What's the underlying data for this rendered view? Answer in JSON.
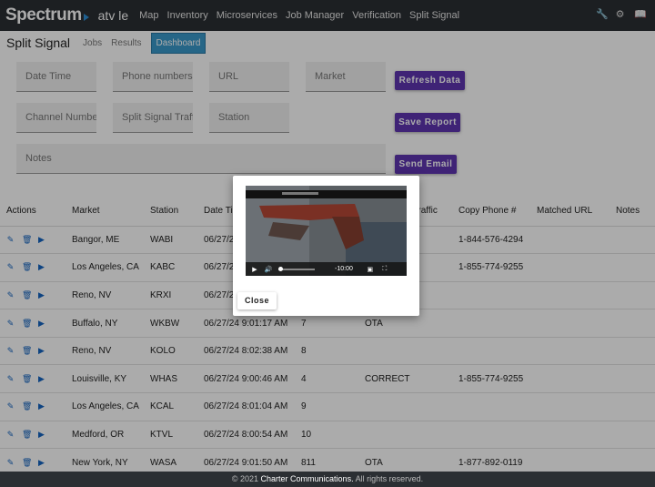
{
  "header": {
    "brand": "Spectrum",
    "app_name": "atv le",
    "nav": [
      "Map",
      "Inventory",
      "Microservices",
      "Job Manager",
      "Verification",
      "Split Signal"
    ],
    "icons": [
      "wrench-icon",
      "gear-icon",
      "book-icon"
    ]
  },
  "subheader": {
    "title": "Split Signal",
    "tabs": [
      {
        "label": "Jobs",
        "active": false
      },
      {
        "label": "Results",
        "active": false
      },
      {
        "label": "Dashboard",
        "active": true
      }
    ]
  },
  "filters": {
    "date_time": "Date Time",
    "phone_numbers": "Phone numbers",
    "url": "URL",
    "market": "Market",
    "channel_number": "Channel Number",
    "split_signal_traffic": "Split Signal Traffic",
    "station": "Station",
    "notes": "Notes"
  },
  "buttons": {
    "refresh": "Refresh Data",
    "save": "Save Report",
    "email": "Send Email"
  },
  "table": {
    "headers": [
      "Actions",
      "Market",
      "Station",
      "Date Time",
      "",
      "Split Signal Traffic",
      "Copy Phone #",
      "Matched URL",
      "Notes"
    ],
    "rows": [
      {
        "market": "Bangor, ME",
        "station": "WABI",
        "datetime": "06/27/24",
        "channel": "",
        "traffic": "",
        "phone": "1-844-576-4294",
        "url": "",
        "notes": ""
      },
      {
        "market": "Los Angeles, CA",
        "station": "KABC",
        "datetime": "06/27/24",
        "channel": "",
        "traffic": "",
        "phone": "1-855-774-9255",
        "url": "",
        "notes": ""
      },
      {
        "market": "Reno, NV",
        "station": "KRXI",
        "datetime": "06/27/24",
        "channel": "",
        "traffic": "",
        "phone": "",
        "url": "",
        "notes": ""
      },
      {
        "market": "Buffalo, NY",
        "station": "WKBW",
        "datetime": "06/27/24 9:01:17 AM",
        "channel": "7",
        "traffic": "OTA",
        "phone": "",
        "url": "",
        "notes": ""
      },
      {
        "market": "Reno, NV",
        "station": "KOLO",
        "datetime": "06/27/24 8:02:38 AM",
        "channel": "8",
        "traffic": "",
        "phone": "",
        "url": "",
        "notes": ""
      },
      {
        "market": "Louisville, KY",
        "station": "WHAS",
        "datetime": "06/27/24 9:00:46 AM",
        "channel": "4",
        "traffic": "CORRECT",
        "phone": "1-855-774-9255",
        "url": "",
        "notes": ""
      },
      {
        "market": "Los Angeles, CA",
        "station": "KCAL",
        "datetime": "06/27/24 8:01:04 AM",
        "channel": "9",
        "traffic": "",
        "phone": "",
        "url": "",
        "notes": ""
      },
      {
        "market": "Medford, OR",
        "station": "KTVL",
        "datetime": "06/27/24 8:00:54 AM",
        "channel": "10",
        "traffic": "",
        "phone": "",
        "url": "",
        "notes": ""
      },
      {
        "market": "New York, NY",
        "station": "WASA",
        "datetime": "06/27/24 9:01:50 AM",
        "channel": "811",
        "traffic": "OTA",
        "phone": "1-877-892-0119",
        "url": "",
        "notes": ""
      }
    ]
  },
  "modal": {
    "video_time": "-10:00",
    "close_label": "Close"
  },
  "footer": {
    "year": "© 2021",
    "company": "Charter Communications.",
    "rights": "All rights reserved."
  }
}
